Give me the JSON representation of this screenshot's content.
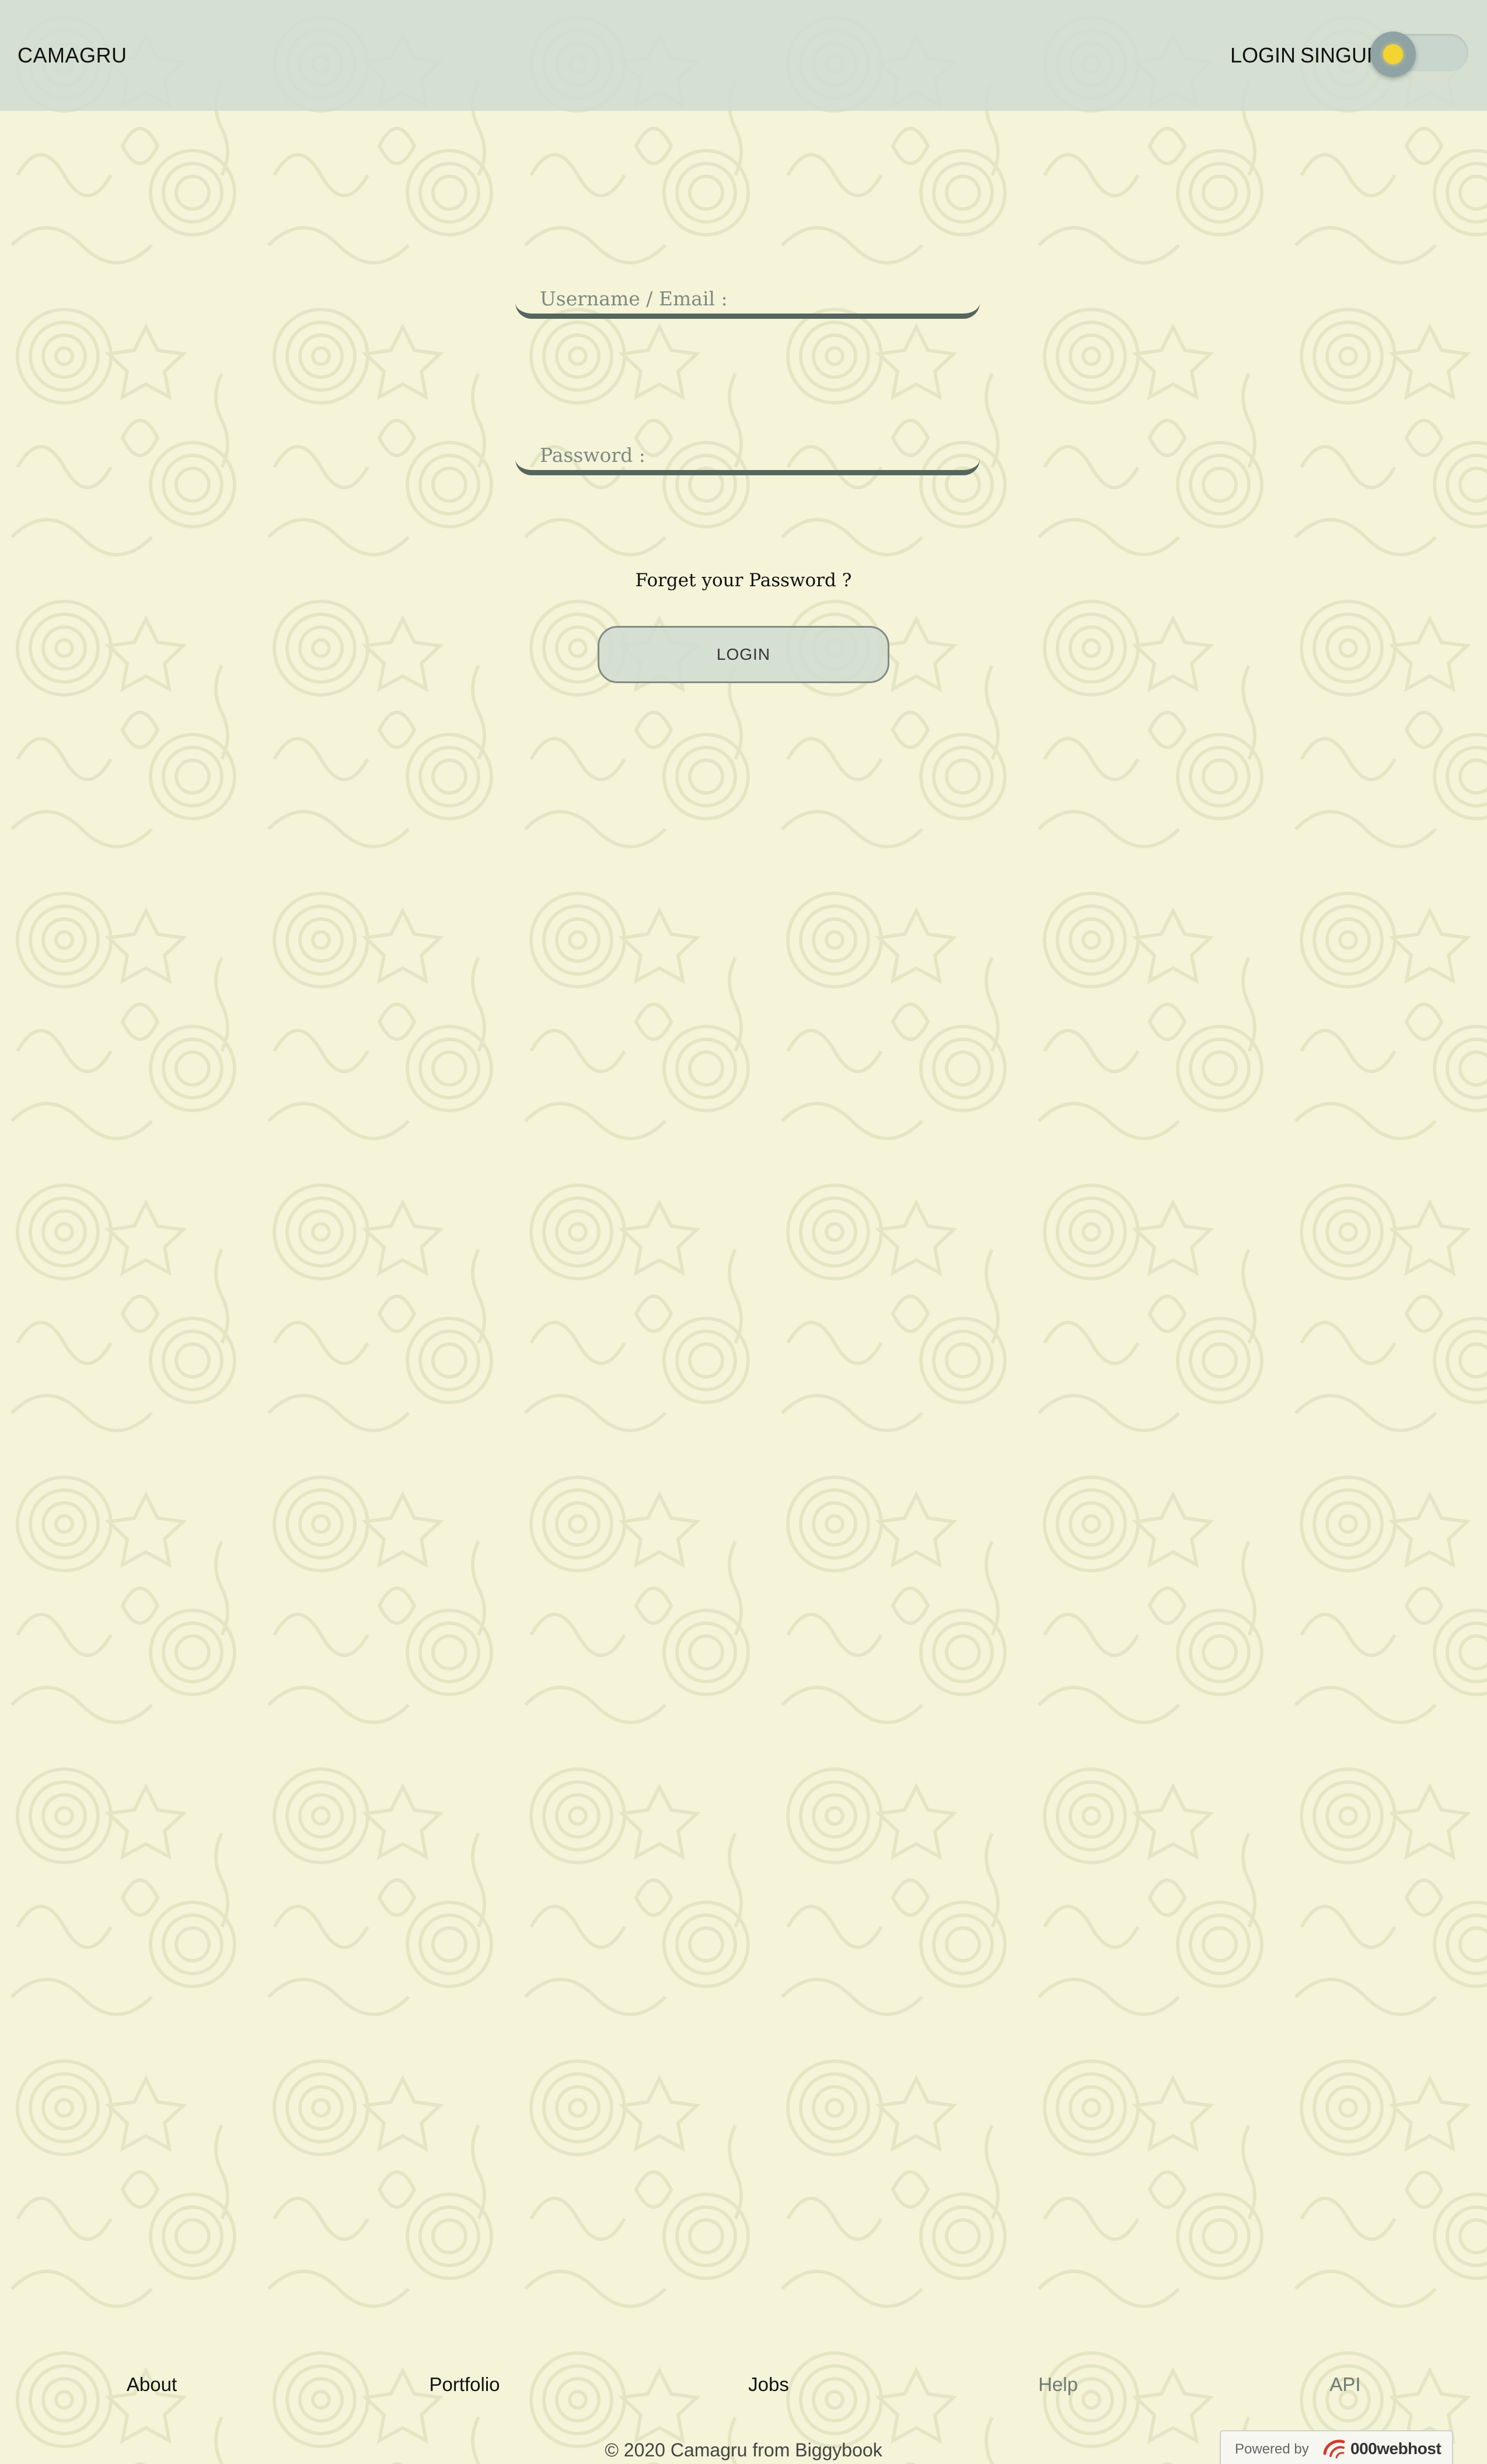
{
  "header": {
    "brand": "CAMAGRU",
    "nav": {
      "login": "LOGIN",
      "signup": "SINGUP"
    },
    "theme_toggle": {
      "icon": "sun-icon",
      "state": "light",
      "sun_color": "#f4d431"
    }
  },
  "login_form": {
    "username": {
      "placeholder": "Username / Email :",
      "value": ""
    },
    "password": {
      "placeholder": "Password :",
      "value": ""
    },
    "forgot_password": "Forget your Password ?",
    "submit_label": "LOGIN"
  },
  "footer": {
    "links": [
      {
        "label": "About"
      },
      {
        "label": "Portfolio"
      },
      {
        "label": "Jobs"
      },
      {
        "label": "Help"
      },
      {
        "label": "API"
      }
    ],
    "copyright": "© 2020 Camagru from Biggybook",
    "powered_by": {
      "text": "Powered by",
      "host": "000webhost",
      "icon": "000webhost-logo-icon"
    }
  },
  "colors": {
    "page_background": "#f5f4d9",
    "header_background": "#d2ddd0",
    "input_underline": "#56665e",
    "host_logo": "#d33a2c"
  }
}
